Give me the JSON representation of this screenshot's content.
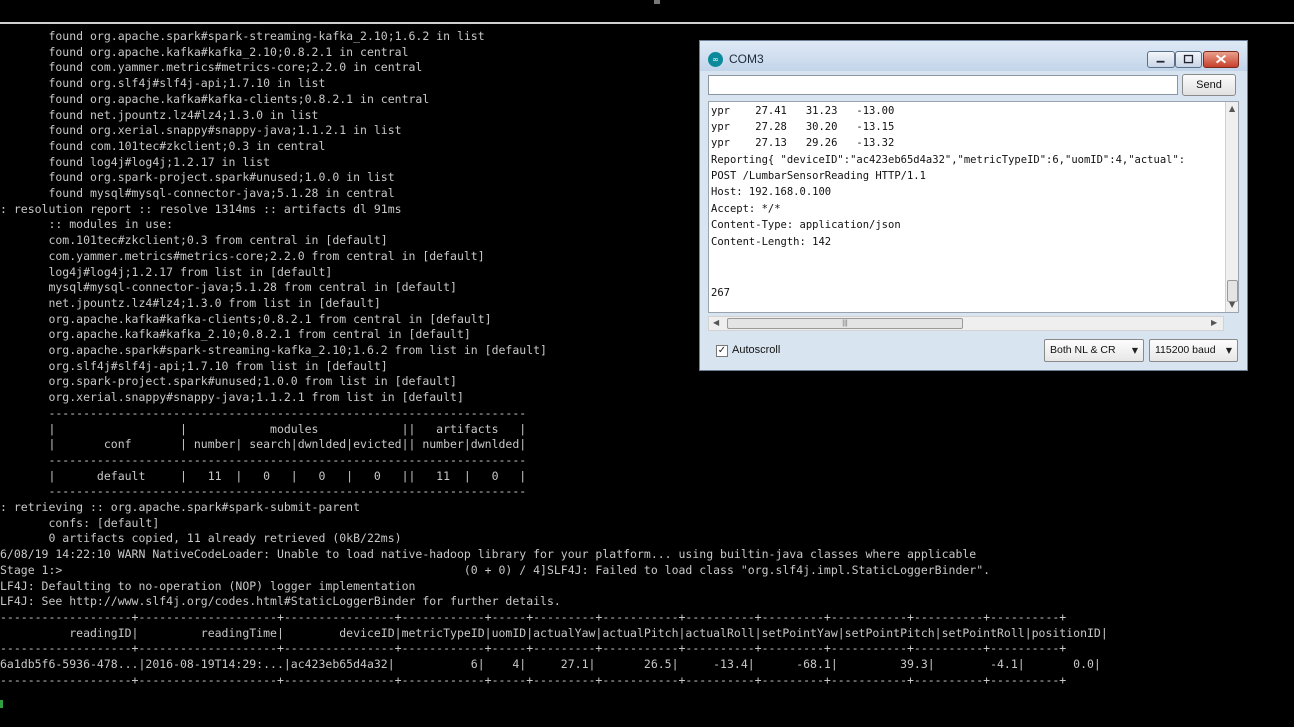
{
  "terminal": {
    "lines": [
      "       found org.apache.spark#spark-streaming-kafka_2.10;1.6.2 in list",
      "       found org.apache.kafka#kafka_2.10;0.8.2.1 in central",
      "       found com.yammer.metrics#metrics-core;2.2.0 in central",
      "       found org.slf4j#slf4j-api;1.7.10 in list",
      "       found org.apache.kafka#kafka-clients;0.8.2.1 in central",
      "       found net.jpountz.lz4#lz4;1.3.0 in list",
      "       found org.xerial.snappy#snappy-java;1.1.2.1 in list",
      "       found com.101tec#zkclient;0.3 in central",
      "       found log4j#log4j;1.2.17 in list",
      "       found org.spark-project.spark#unused;1.0.0 in list",
      "       found mysql#mysql-connector-java;5.1.28 in central",
      ": resolution report :: resolve 1314ms :: artifacts dl 91ms",
      "       :: modules in use:",
      "       com.101tec#zkclient;0.3 from central in [default]",
      "       com.yammer.metrics#metrics-core;2.2.0 from central in [default]",
      "       log4j#log4j;1.2.17 from list in [default]",
      "       mysql#mysql-connector-java;5.1.28 from central in [default]",
      "       net.jpountz.lz4#lz4;1.3.0 from list in [default]",
      "       org.apache.kafka#kafka-clients;0.8.2.1 from central in [default]",
      "       org.apache.kafka#kafka_2.10;0.8.2.1 from central in [default]",
      "       org.apache.spark#spark-streaming-kafka_2.10;1.6.2 from list in [default]",
      "       org.slf4j#slf4j-api;1.7.10 from list in [default]",
      "       org.spark-project.spark#unused;1.0.0 from list in [default]",
      "       org.xerial.snappy#snappy-java;1.1.2.1 from list in [default]",
      "       ---------------------------------------------------------------------",
      "       |                  |            modules            ||   artifacts   |",
      "       |       conf       | number| search|dwnlded|evicted|| number|dwnlded|",
      "       ---------------------------------------------------------------------",
      "       |      default     |   11  |   0   |   0   |   0   ||   11  |   0   |",
      "       ---------------------------------------------------------------------",
      ": retrieving :: org.apache.spark#spark-submit-parent",
      "       confs: [default]",
      "       0 artifacts copied, 11 already retrieved (0kB/22ms)",
      "6/08/19 14:22:10 WARN NativeCodeLoader: Unable to load native-hadoop library for your platform... using builtin-java classes where applicable",
      "Stage 1:>                                                          (0 + 0) / 4]SLF4J: Failed to load class \"org.slf4j.impl.StaticLoggerBinder\".",
      "LF4J: Defaulting to no-operation (NOP) logger implementation",
      "LF4J: See http://www.slf4j.org/codes.html#StaticLoggerBinder for further details.",
      "-------------------+--------------------+----------------+------------+-----+---------+-----------+----------+---------+-----------+----------+----------+",
      "          readingID|         readingTime|        deviceID|metricTypeID|uomID|actualYaw|actualPitch|actualRoll|setPointYaw|setPointPitch|setPointRoll|positionID|",
      "-------------------+--------------------+----------------+------------+-----+---------+-----------+----------+---------+-----------+----------+----------+",
      "6a1db5f6-5936-478...|2016-08-19T14:29:...|ac423eb65d4a32|           6|    4|     27.1|       26.5|     -13.4|      -68.1|         39.3|        -4.1|       0.0|",
      "-------------------+--------------------+----------------+------------+-----+---------+-----------+----------+---------+-----------+----------+----------+"
    ]
  },
  "serial_monitor": {
    "title": "COM3",
    "icon": "infinity-icon",
    "send_label": "Send",
    "input_value": "",
    "output_lines": [
      "ypr    27.41   31.23   -13.00",
      "ypr    27.28   30.20   -13.15",
      "ypr    27.13   29.26   -13.32",
      "Reporting{ \"deviceID\":\"ac423eb65d4a32\",\"metricTypeID\":6,\"uomID\":4,\"actual\":",
      "POST /LumbarSensorReading HTTP/1.1",
      "Host: 192.168.0.100",
      "Accept: */*",
      "Content-Type: application/json",
      "Content-Length: 142",
      "",
      "",
      "267"
    ],
    "autoscroll_label": "Autoscroll",
    "autoscroll_checked": true,
    "line_ending": "Both NL & CR",
    "baud_rate": "115200 baud",
    "colors": {
      "close_button": "#c6402b",
      "title_bar": "#c3d5ea"
    }
  }
}
